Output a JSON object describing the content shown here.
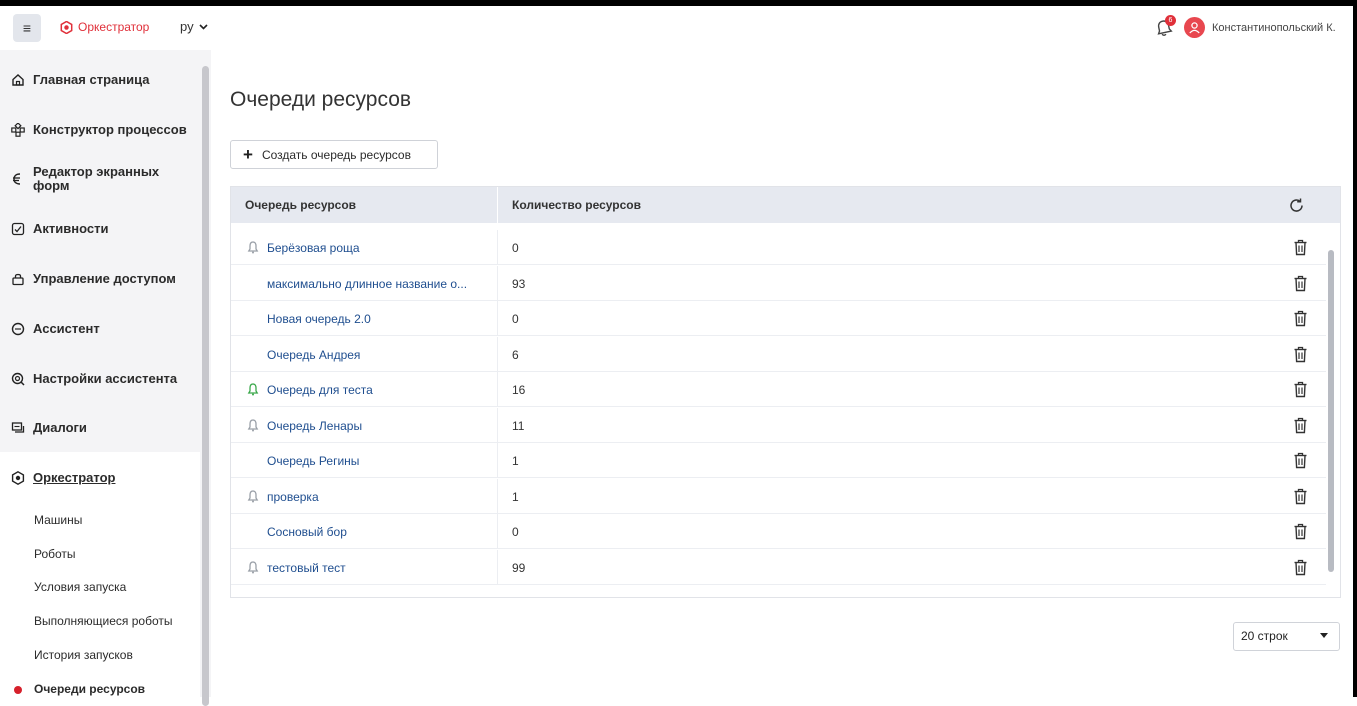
{
  "header": {
    "menu_icon": "hamburger-icon",
    "app_name": "Оркестратор",
    "language": "ру",
    "notifications_count": "6",
    "user_name": "Константинопольский К.",
    "brand_color": "#e0303a"
  },
  "sidebar": {
    "items": [
      {
        "label": "Главная страница",
        "icon": "home-icon"
      },
      {
        "label": "Конструктор процессов",
        "icon": "process-icon"
      },
      {
        "label": "Редактор экранных форм",
        "icon": "form-editor-icon"
      },
      {
        "label": "Активности",
        "icon": "activities-icon"
      },
      {
        "label": "Управление доступом",
        "icon": "access-icon"
      },
      {
        "label": "Ассистент",
        "icon": "assistant-icon"
      },
      {
        "label": "Настройки ассистента",
        "icon": "assistant-settings-icon"
      },
      {
        "label": "Диалоги",
        "icon": "dialogs-icon"
      },
      {
        "label": "Оркестратор",
        "icon": "orchestrator-icon"
      }
    ],
    "orchestrator_sub": [
      "Машины",
      "Роботы",
      "Условия запуска",
      "Выполняющиеся роботы",
      "История запусков",
      "Очереди ресурсов"
    ],
    "current_sub": "Очереди ресурсов"
  },
  "main": {
    "title": "Очереди ресурсов",
    "create_button": "Создать очередь ресурсов",
    "table": {
      "columns": [
        "Очередь ресурсов",
        "Количество ресурсов"
      ],
      "rows": [
        {
          "name": "Берёзовая роща",
          "count": "0",
          "status": "grey"
        },
        {
          "name": "максимально длинное название о...",
          "count": "93",
          "status": "none"
        },
        {
          "name": "Новая очередь 2.0",
          "count": "0",
          "status": "none"
        },
        {
          "name": "Очередь Андрея",
          "count": "6",
          "status": "none"
        },
        {
          "name": "Очередь для теста",
          "count": "16",
          "status": "green"
        },
        {
          "name": "Очередь Ленары",
          "count": "11",
          "status": "grey"
        },
        {
          "name": "Очередь Регины",
          "count": "1",
          "status": "none"
        },
        {
          "name": "проверка",
          "count": "1",
          "status": "grey"
        },
        {
          "name": "Сосновый бор",
          "count": "0",
          "status": "none"
        },
        {
          "name": "тестовый тест",
          "count": "99",
          "status": "grey"
        }
      ]
    },
    "rows_per_page": "20 строк"
  }
}
